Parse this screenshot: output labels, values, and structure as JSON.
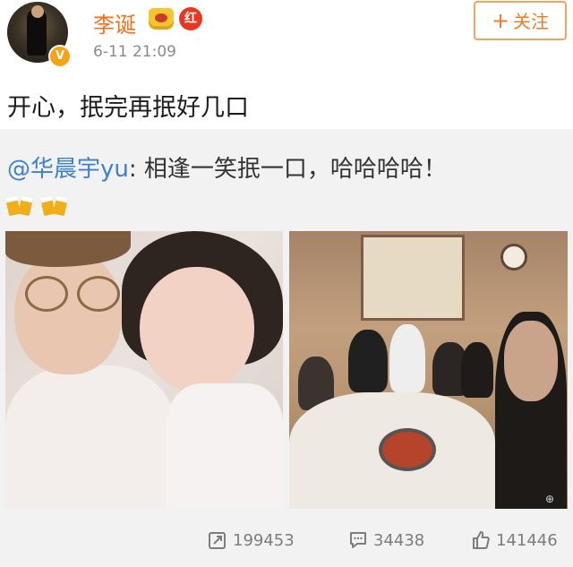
{
  "user": {
    "name": "李诞",
    "timestamp": "6-11 21:09",
    "verified_badge": "V",
    "red_badge": "红",
    "icons": [
      "avatar",
      "verified-icon",
      "crown-icon",
      "red-badge-icon"
    ]
  },
  "follow": {
    "plus": "+",
    "label": "关注"
  },
  "post": {
    "text": "开心，抿完再抿好几口"
  },
  "repost": {
    "mention": "@华晨宇yu",
    "text": ": 相逢一笑抿一口，哈哈哈哈！",
    "emoji": [
      "beer-cheers-icon",
      "beer-cheers-icon"
    ],
    "images": [
      {
        "name": "selfie-photo"
      },
      {
        "name": "dinner-photo"
      }
    ],
    "watermark": "⊕"
  },
  "actions": {
    "repost_count": "199453",
    "comment_count": "34438",
    "like_count": "141446"
  },
  "colors": {
    "username": "#f26f19",
    "mention": "#3f7fcf",
    "follow_border": "#f6a35b",
    "repost_bg": "#f2f2f2",
    "action_text": "#7d7d7d"
  }
}
